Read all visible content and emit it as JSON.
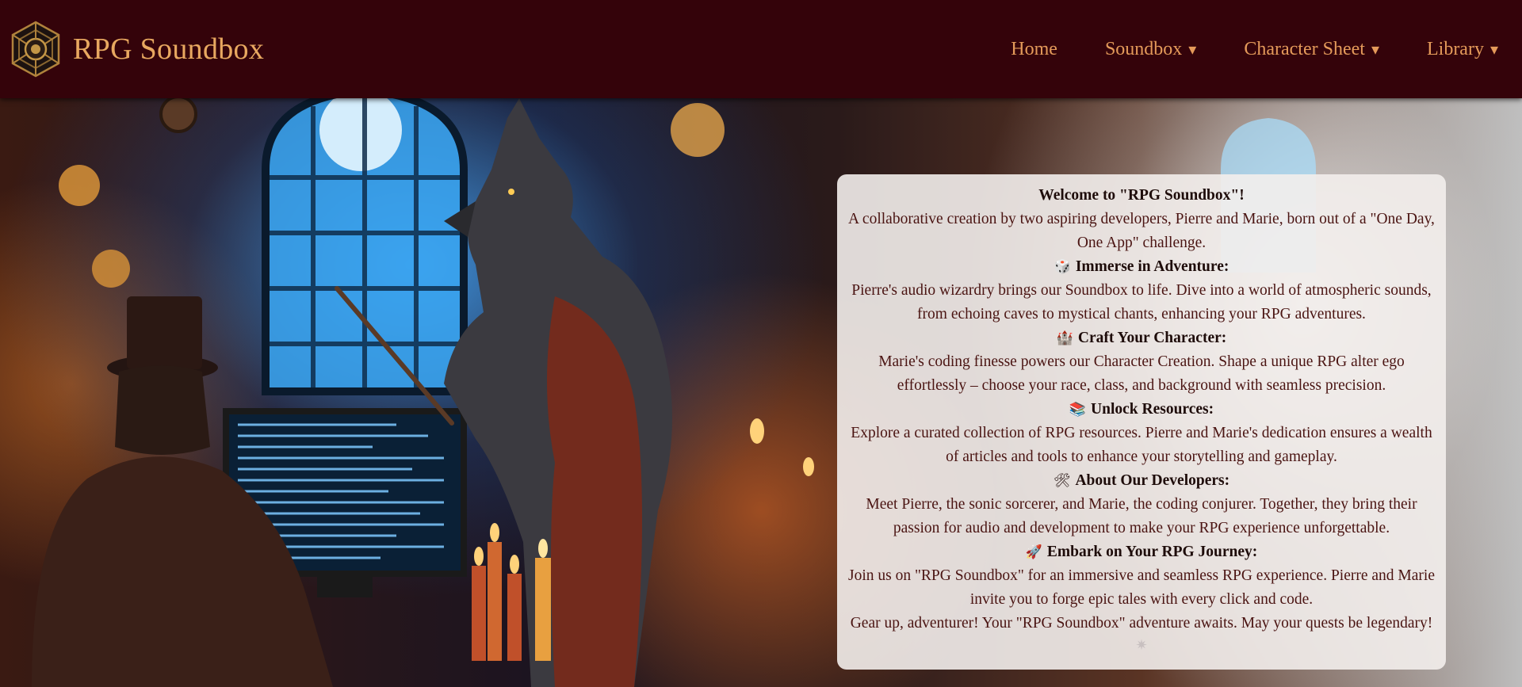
{
  "brand": {
    "name": "RPG Soundbox",
    "logo_icon": "d20-dice-logo-icon"
  },
  "nav": {
    "items": [
      {
        "label": "Home",
        "has_dropdown": false
      },
      {
        "label": "Soundbox",
        "has_dropdown": true
      },
      {
        "label": "Character Sheet",
        "has_dropdown": true
      },
      {
        "label": "Library",
        "has_dropdown": true
      }
    ],
    "caret": "▾"
  },
  "hero": {
    "image_subject": "werewolf-teacher-and-wizard-at-computer"
  },
  "welcome": {
    "title": "Welcome to \"RPG Soundbox\"!",
    "intro": "A collaborative creation by two aspiring developers, Pierre and Marie, born out of a \"One Day, One App\" challenge.",
    "sections": [
      {
        "icon": "🎲",
        "icon_name": "dice-icon",
        "heading": "Immerse in Adventure:",
        "body": "Pierre's audio wizardry brings our Soundbox to life. Dive into a world of atmospheric sounds, from echoing caves to mystical chants, enhancing your RPG adventures."
      },
      {
        "icon": "🏰",
        "icon_name": "castle-icon",
        "heading": "Craft Your Character:",
        "body": "Marie's coding finesse powers our Character Creation. Shape a unique RPG alter ego effortlessly – choose your race, class, and background with seamless precision."
      },
      {
        "icon": "📚",
        "icon_name": "books-icon",
        "heading": "Unlock Resources:",
        "body": "Explore a curated collection of RPG resources. Pierre and Marie's dedication ensures a wealth of articles and tools to enhance your storytelling and gameplay."
      },
      {
        "icon": "🛠",
        "icon_name": "tools-icon",
        "heading": "About Our Developers:",
        "body": "Meet Pierre, the sonic sorcerer, and Marie, the coding conjurer. Together, they bring their passion for audio and development to make your RPG experience unforgettable."
      },
      {
        "icon": "🚀",
        "icon_name": "rocket-icon",
        "heading": "Embark on Your RPG Journey:",
        "body": "Join us on \"RPG Soundbox\" for an immersive and seamless RPG experience. Pierre and Marie invite you to forge epic tales with every click and code."
      }
    ],
    "closing": "Gear up, adventurer! Your \"RPG Soundbox\" adventure awaits. May your quests be legendary!",
    "footer_icon": "✷",
    "footer_icon_name": "sparkle-icon"
  },
  "colors": {
    "navbar_bg": "#34030a",
    "brand_text": "#e8a860",
    "nav_text": "#e49a5a",
    "card_bg": "#f3eeec",
    "card_body_text": "#4a1412",
    "card_heading_text": "#1e0c0a"
  }
}
